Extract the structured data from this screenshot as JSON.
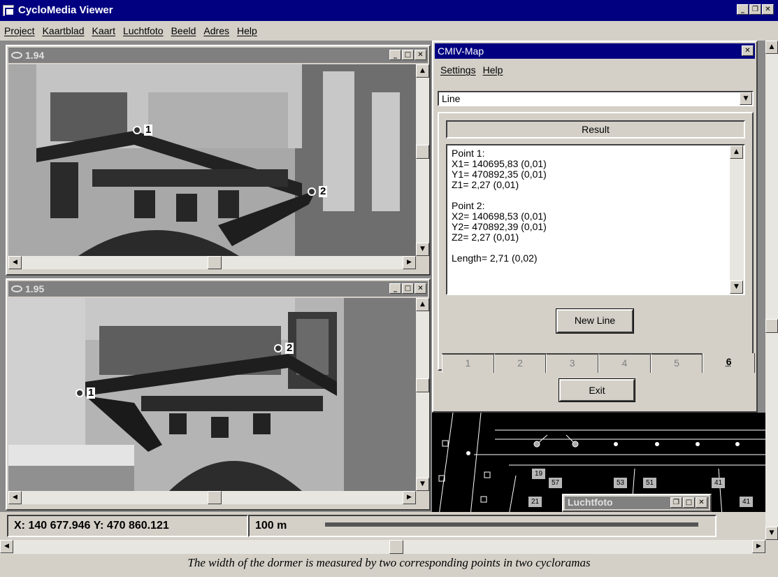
{
  "app": {
    "title": "CycloMedia Viewer"
  },
  "menu": [
    "Project",
    "Kaartblad",
    "Kaart",
    "Luchtfoto",
    "Beeld",
    "Adres",
    "Help"
  ],
  "view1": {
    "title": "1.94",
    "points": [
      "1",
      "2"
    ]
  },
  "view2": {
    "title": "1.95",
    "points": [
      "1",
      "2"
    ]
  },
  "cmiv": {
    "title": "CMIV-Map",
    "menu": [
      "Settings",
      "Help"
    ],
    "mode": "Line",
    "result_header": "Result",
    "result_lines": [
      "Point 1:",
      "X1= 140695,83  (0,01)",
      "Y1= 470892,35  (0,01)",
      "Z1= 2,27  (0,01)",
      "",
      "Point 2:",
      "X2= 140698,53  (0,01)",
      "Y2= 470892,39  (0,01)",
      "Z2= 2,27  (0,01)",
      "",
      "Length= 2,71  (0,02)"
    ],
    "new_line_label": "New Line",
    "tabs": [
      "1",
      "2",
      "3",
      "4",
      "5",
      "6"
    ],
    "active_tab": "6",
    "exit_label": "Exit"
  },
  "map": {
    "labels": [
      "19",
      "57",
      "53",
      "51",
      "41",
      "21",
      "41"
    ]
  },
  "luchtfoto": {
    "title": "Luchtfoto"
  },
  "status": {
    "coords": "X: 140 677.946 Y: 470 860.121",
    "scale": "100 m"
  },
  "caption": "The width of the dormer is measured by two corresponding points in two cycloramas"
}
